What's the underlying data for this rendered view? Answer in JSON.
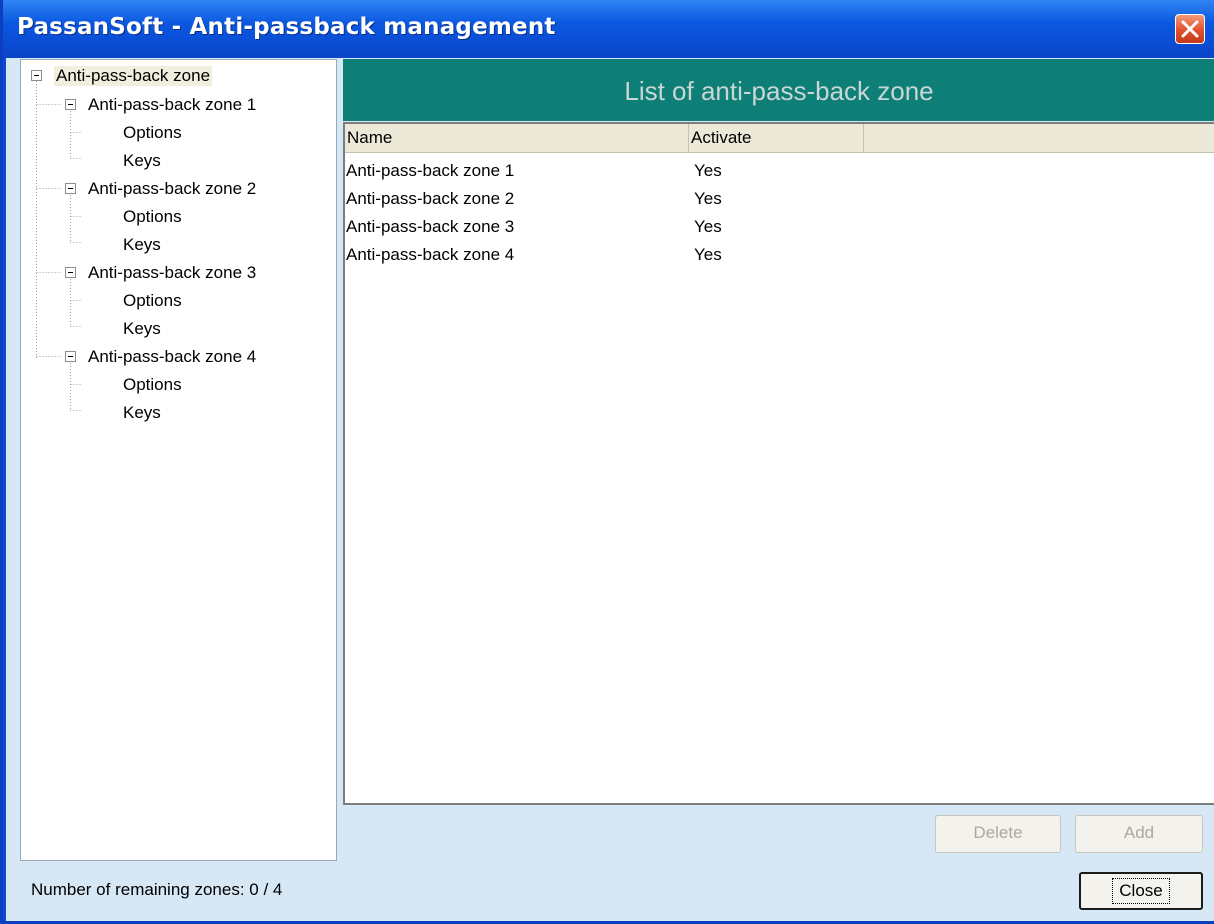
{
  "window": {
    "title": "PassanSoft - Anti-passback management"
  },
  "tree": {
    "root": "Anti-pass-back zone",
    "zones": [
      {
        "label": "Anti-pass-back zone 1",
        "children": [
          "Options",
          "Keys"
        ]
      },
      {
        "label": "Anti-pass-back zone 2",
        "children": [
          "Options",
          "Keys"
        ]
      },
      {
        "label": "Anti-pass-back zone 3",
        "children": [
          "Options",
          "Keys"
        ]
      },
      {
        "label": "Anti-pass-back zone 4",
        "children": [
          "Options",
          "Keys"
        ]
      }
    ]
  },
  "list": {
    "title": "List of anti-pass-back zone",
    "columns": [
      "Name",
      "Activate"
    ],
    "rows": [
      [
        "Anti-pass-back zone 1",
        "Yes"
      ],
      [
        "Anti-pass-back zone 2",
        "Yes"
      ],
      [
        "Anti-pass-back zone 3",
        "Yes"
      ],
      [
        "Anti-pass-back zone 4",
        "Yes"
      ]
    ]
  },
  "buttons": {
    "delete": "Delete",
    "add": "Add",
    "close": "Close"
  },
  "status": {
    "remaining_zones": "Number of remaining zones: 0 / 4"
  },
  "colors": {
    "titlebar": "#0a4ed6",
    "panel_header": "#0e7f77",
    "client_bg": "#d6e7f5"
  }
}
